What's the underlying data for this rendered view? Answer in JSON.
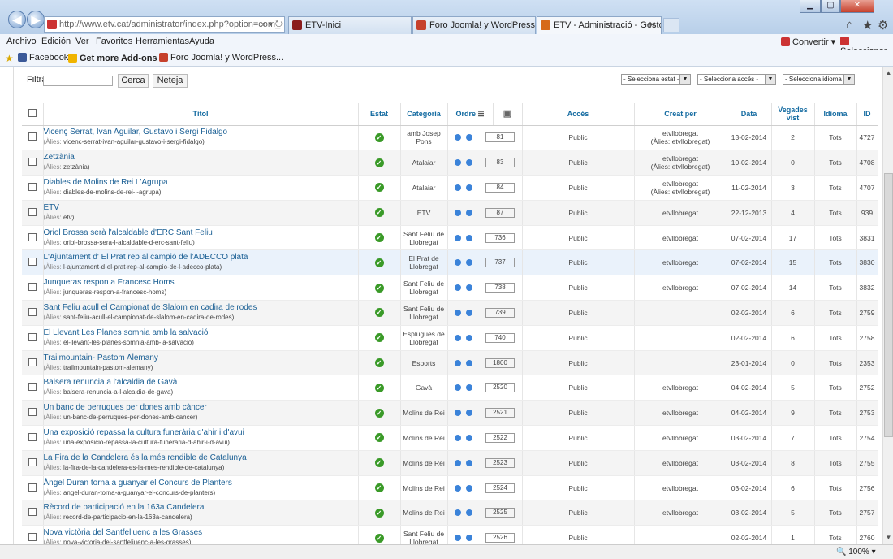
{
  "browser": {
    "address": "http://www.etv.cat/administrator/index.php?option=com_",
    "address_host": "etv.cat",
    "tabs": [
      {
        "label": "ETV-Inici",
        "color": "#8a1c1c"
      },
      {
        "label": "Foro Joomla! y WordPress :: Re...",
        "color": "#c6402c"
      },
      {
        "label": "ETV - Administració - Gesto...",
        "color": "#d66a1a"
      }
    ],
    "menu": [
      "Archivo",
      "Edición",
      "Ver",
      "Favoritos",
      "Herramientas",
      "Ayuda"
    ],
    "convert_label": "Convertir",
    "select_label": "Seleccionar",
    "favorites": [
      {
        "label": "Facebook",
        "color": "#3b5998"
      },
      {
        "label": "Get more Add-ons",
        "color": "#f0b400"
      },
      {
        "label": "Foro Joomla! y WordPress...",
        "color": "#c6402c"
      }
    ],
    "zoom": "100%"
  },
  "toolbar": {
    "filter_label": "Filtra",
    "filter_value": "",
    "search_button": "Cerca",
    "clear_button": "Neteja",
    "state_select": "- Selecciona estat -",
    "access_select": "- Selecciona accés -",
    "language_select": "- Selecciona idioma -"
  },
  "table": {
    "headers": {
      "title": "Títol",
      "state": "Estat",
      "category": "Categoria",
      "order": "Ordre",
      "access": "Accés",
      "created_by": "Creat per",
      "date": "Data",
      "views": "Vegades vist",
      "language": "Idioma",
      "id": "ID"
    },
    "alias_prefix": "(Àlies:",
    "rows": [
      {
        "title": "Vicenç Serrat, Ivan Aguilar, Gustavo i Sergi Fidalgo",
        "alias": "vicenc-serrat-ivan-aguilar-gustavo-i-sergi-fidalgo)",
        "category": "amb Josep Pons",
        "order": "81",
        "access": "Public",
        "author": "etvllobregat",
        "author_alias": "(Àlies: etvllobregat)",
        "date": "13-02-2014",
        "hits": "2",
        "lang": "Tots",
        "id": "4727"
      },
      {
        "title": "Zetzània",
        "alias": "zetzània)",
        "category": "Atalaiar",
        "order": "83",
        "access": "Public",
        "author": "etvllobregat",
        "author_alias": "(Àlies: etvllobregat)",
        "date": "10-02-2014",
        "hits": "0",
        "lang": "Tots",
        "id": "4708"
      },
      {
        "title": "Diables de Molins de Rei L'Agrupa",
        "alias": "diables-de-molins-de-rei-l-agrupa)",
        "category": "Atalaiar",
        "order": "84",
        "access": "Public",
        "author": "etvllobregat",
        "author_alias": "(Àlies: etvllobregat)",
        "date": "11-02-2014",
        "hits": "3",
        "lang": "Tots",
        "id": "4707"
      },
      {
        "title": "ETV",
        "alias": "etv)",
        "category": "ETV",
        "order": "87",
        "access": "Public",
        "author": "etvllobregat",
        "author_alias": "",
        "date": "22-12-2013",
        "hits": "4",
        "lang": "Tots",
        "id": "939"
      },
      {
        "title": "Oriol Brossa serà l'alcaldable d'ERC Sant Feliu",
        "alias": "oriol-brossa-sera-l-alcaldable-d-erc-sant-feliu)",
        "category": "Sant Feliu de Llobregat",
        "order": "736",
        "access": "Public",
        "author": "etvllobregat",
        "author_alias": "",
        "date": "07-02-2014",
        "hits": "17",
        "lang": "Tots",
        "id": "3831"
      },
      {
        "title": "L'Ajuntament d' El Prat rep al campió de l'ADECCO plata",
        "alias": "l-ajuntament-d-el-prat-rep-al-campio-de-l-adecco-plata)",
        "category": "El Prat de Llobregat",
        "order": "737",
        "access": "Public",
        "author": "etvllobregat",
        "author_alias": "",
        "date": "07-02-2014",
        "hits": "15",
        "lang": "Tots",
        "id": "3830"
      },
      {
        "title": "Junqueras respon a Francesc Homs",
        "alias": "junqueras-respon-a-francesc-homs)",
        "category": "Sant Feliu de Llobregat",
        "order": "738",
        "access": "Public",
        "author": "etvllobregat",
        "author_alias": "",
        "date": "07-02-2014",
        "hits": "14",
        "lang": "Tots",
        "id": "3832"
      },
      {
        "title": "Sant Feliu acull el Campionat de Slalom en cadira de rodes",
        "alias": "sant-feliu-acull-el-campionat-de-slalom-en-cadira-de-rodes)",
        "category": "Sant Feliu de Llobregat",
        "order": "739",
        "access": "Public",
        "author": "",
        "author_alias": "",
        "date": "02-02-2014",
        "hits": "6",
        "lang": "Tots",
        "id": "2759"
      },
      {
        "title": "El Llevant Les Planes somnia amb la salvació",
        "alias": "el-llevant-les-planes-somnia-amb-la-salvacio)",
        "category": "Esplugues de Llobregat",
        "order": "740",
        "access": "Public",
        "author": "",
        "author_alias": "",
        "date": "02-02-2014",
        "hits": "6",
        "lang": "Tots",
        "id": "2758"
      },
      {
        "title": "Trailmountain- Pastom Alemany",
        "alias": "trailmountain-pastom-alemany)",
        "category": "Esports",
        "order": "1800",
        "access": "Public",
        "author": "",
        "author_alias": "",
        "date": "23-01-2014",
        "hits": "0",
        "lang": "Tots",
        "id": "2353"
      },
      {
        "title": "Balsera renuncia a l'alcaldia de Gavà",
        "alias": "balsera-renuncia-a-l-alcaldia-de-gava)",
        "category": "Gavà",
        "order": "2520",
        "access": "Public",
        "author": "etvllobregat",
        "author_alias": "",
        "date": "04-02-2014",
        "hits": "5",
        "lang": "Tots",
        "id": "2752"
      },
      {
        "title": "Un banc de perruques per dones amb càncer",
        "alias": "un-banc-de-perruques-per-dones-amb-cancer)",
        "category": "Molins de Rei",
        "order": "2521",
        "access": "Public",
        "author": "etvllobregat",
        "author_alias": "",
        "date": "04-02-2014",
        "hits": "9",
        "lang": "Tots",
        "id": "2753"
      },
      {
        "title": "Una exposició repassa la cultura funerària d'ahir i d'avui",
        "alias": "una-exposicio-repassa-la-cultura-funeraria-d-ahir-i-d-avui)",
        "category": "Molins de Rei",
        "order": "2522",
        "access": "Public",
        "author": "etvllobregat",
        "author_alias": "",
        "date": "03-02-2014",
        "hits": "7",
        "lang": "Tots",
        "id": "2754"
      },
      {
        "title": "La Fira de la Candelera és la més rendible de Catalunya",
        "alias": "la-fira-de-la-candelera-es-la-mes-rendible-de-catalunya)",
        "category": "Molins de Rei",
        "order": "2523",
        "access": "Public",
        "author": "etvllobregat",
        "author_alias": "",
        "date": "03-02-2014",
        "hits": "8",
        "lang": "Tots",
        "id": "2755"
      },
      {
        "title": "Àngel Duran torna a guanyar el Concurs de Planters",
        "alias": "angel-duran-torna-a-guanyar-el-concurs-de-planters)",
        "category": "Molins de Rei",
        "order": "2524",
        "access": "Public",
        "author": "etvllobregat",
        "author_alias": "",
        "date": "03-02-2014",
        "hits": "6",
        "lang": "Tots",
        "id": "2756"
      },
      {
        "title": "Rècord de participació en la 163a Candelera",
        "alias": "record-de-participacio-en-la-163a-candelera)",
        "category": "Molins de Rei",
        "order": "2525",
        "access": "Public",
        "author": "etvllobregat",
        "author_alias": "",
        "date": "03-02-2014",
        "hits": "5",
        "lang": "Tots",
        "id": "2757"
      },
      {
        "title": "Nova victòria del Santfeliuenc a les Grasses",
        "alias": "nova-victoria-del-santfeliuenc-a-les-grasses)",
        "category": "Sant Feliu de Llobregat",
        "order": "2526",
        "access": "Public",
        "author": "",
        "author_alias": "",
        "date": "02-02-2014",
        "hits": "1",
        "lang": "Tots",
        "id": "2760"
      }
    ]
  }
}
